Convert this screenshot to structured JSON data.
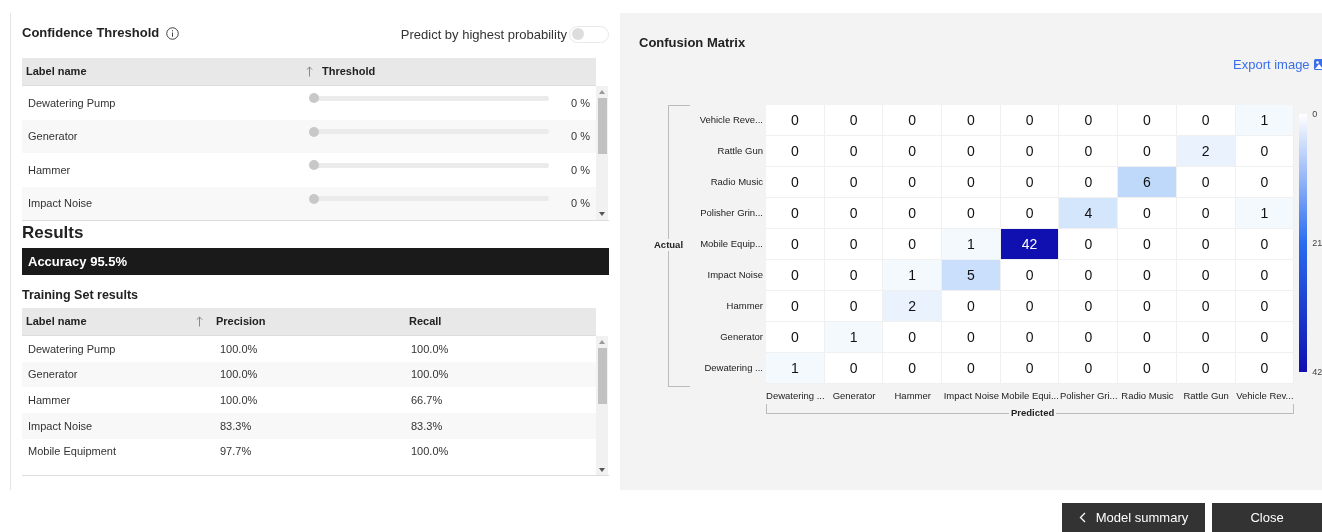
{
  "confidence_threshold": {
    "title": "Confidence Threshold",
    "toggle": {
      "label": "Predict by highest probability",
      "on": false
    },
    "columns": [
      "Label name",
      "Threshold"
    ],
    "rows": [
      {
        "label": "Dewatering Pump",
        "level": 0,
        "reading": "0 %"
      },
      {
        "label": "Generator",
        "level": 0,
        "reading": "0 %"
      },
      {
        "label": "Hammer",
        "level": 0,
        "reading": "0 %"
      },
      {
        "label": "Impact Noise",
        "level": 0,
        "reading": "0 %"
      }
    ]
  },
  "results": {
    "title": "Results",
    "accuracy": "Accuracy 95.5%",
    "training_title": "Training Set results",
    "columns": [
      "Label name",
      "Precision",
      "Recall"
    ],
    "rows": [
      [
        "Dewatering Pump",
        "100.0%",
        "100.0%"
      ],
      [
        "Generator",
        "100.0%",
        "100.0%"
      ],
      [
        "Hammer",
        "100.0%",
        "66.7%"
      ],
      [
        "Impact Noise",
        "83.3%",
        "83.3%"
      ],
      [
        "Mobile Equipment",
        "97.7%",
        "100.0%"
      ]
    ]
  },
  "confusion_matrix": {
    "title": "Confusion Matrix",
    "export": "Export image",
    "y_title": "Actual",
    "x_title": "Predicted",
    "row_labels": [
      "Vehicle Reve...",
      "Rattle Gun",
      "Radio Music",
      "Polisher Grin...",
      "Mobile Equip...",
      "Impact Noise",
      "Hammer",
      "Generator",
      "Dewatering ..."
    ],
    "col_labels": [
      "Dewatering ...",
      "Generator",
      "Hammer",
      "Impact Noise",
      "Mobile Equi...",
      "Polisher Gri...",
      "Radio Music",
      "Rattle Gun",
      "Vehicle Rev..."
    ],
    "cells": [
      [
        "0",
        "0",
        "0",
        "0",
        "0",
        "0",
        "0",
        "0",
        "1"
      ],
      [
        "0",
        "0",
        "0",
        "0",
        "0",
        "0",
        "0",
        "2",
        "0"
      ],
      [
        "0",
        "0",
        "0",
        "0",
        "0",
        "0",
        "6",
        "0",
        "0"
      ],
      [
        "0",
        "0",
        "0",
        "0",
        "0",
        "4",
        "0",
        "0",
        "1"
      ],
      [
        "0",
        "0",
        "0",
        "1",
        "42",
        "0",
        "0",
        "0",
        "0"
      ],
      [
        "0",
        "0",
        "1",
        "5",
        "0",
        "0",
        "0",
        "0",
        "0"
      ],
      [
        "0",
        "0",
        "2",
        "0",
        "0",
        "0",
        "0",
        "0",
        "0"
      ],
      [
        "0",
        "1",
        "0",
        "0",
        "0",
        "0",
        "0",
        "0",
        "0"
      ],
      [
        "1",
        "0",
        "0",
        "0",
        "0",
        "0",
        "0",
        "0",
        "0"
      ]
    ],
    "legend_ticks": [
      "0",
      "21",
      "42"
    ]
  },
  "buttons": [
    {
      "kind": "back",
      "label": "Model summary"
    },
    {
      "kind": "plain",
      "label": "Close"
    }
  ]
}
